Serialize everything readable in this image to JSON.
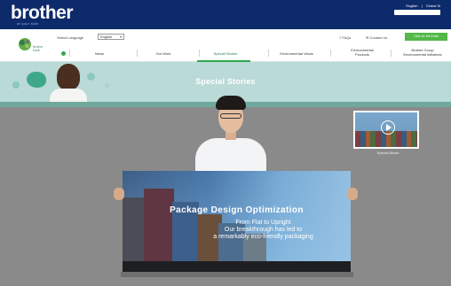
{
  "header": {
    "logo": "brother",
    "tagline": "at your side",
    "top_links": [
      "English",
      "|",
      "Global Si"
    ]
  },
  "utility": {
    "language_label": "Select Language",
    "language_value": "English",
    "faq": "? FAQs",
    "contact": "✉ Contact Us",
    "green_button": "Click for the Earth"
  },
  "eco_logo": {
    "line1": "Brother",
    "line2": "Earth"
  },
  "nav": {
    "items": [
      {
        "label": "News"
      },
      {
        "label": "Our Work"
      },
      {
        "label": "Special Stories"
      },
      {
        "label": "Environmental Views"
      },
      {
        "label": "Environmental\nProducts"
      },
      {
        "label": "Brother Group\nEnvironmental Initiatives"
      }
    ]
  },
  "banner": {
    "title": "Special Stories"
  },
  "poster": {
    "title": "Package Design Optimization",
    "line1": "From Flat to Upright",
    "line2": "Our breakthrough has led to",
    "line3": "a remarkably eco-friendly packaging"
  },
  "video": {
    "caption": "Special Movie"
  },
  "colors": {
    "navy": "#0d2a6b",
    "green": "#52b848",
    "banner": "#b9dad7",
    "content_gray": "#8a8a8a"
  }
}
